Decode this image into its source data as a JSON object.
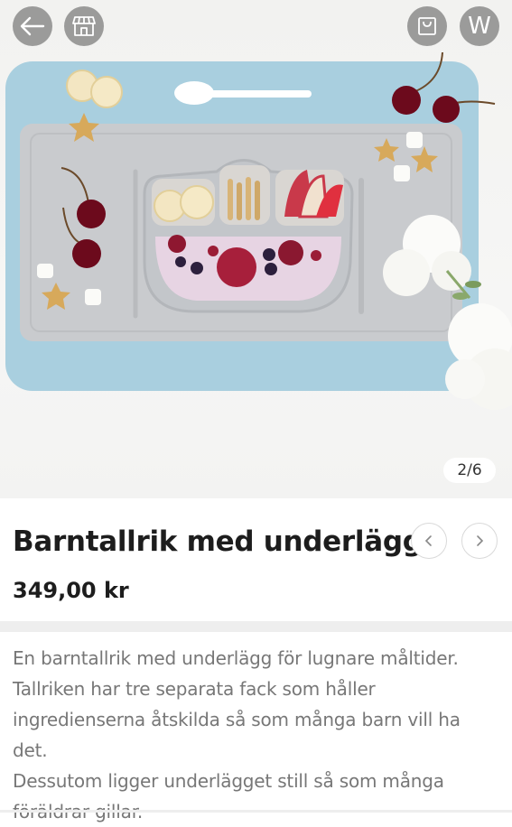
{
  "gallery": {
    "counter": "2/6",
    "back_icon": "arrow-left-icon",
    "store_icon": "storefront-icon",
    "bag_icon": "shopping-bag-icon",
    "account_letter": "W",
    "mat_color": "#a9cfdf",
    "plate_color": "#c8cacd"
  },
  "product": {
    "title": "Barntallrik med underlägg",
    "price": "349,00 kr",
    "prev_icon": "chevron-left-icon",
    "next_icon": "chevron-right-icon"
  },
  "description": {
    "lines": [
      "En barntallrik med underlägg för lugnare måltider.",
      "Tallriken har tre separata fack som håller",
      "ingredienserna åtskilda så som många barn vill ha det.",
      "Dessutom ligger underlägget still så som många",
      "föräldrar gillar."
    ]
  }
}
